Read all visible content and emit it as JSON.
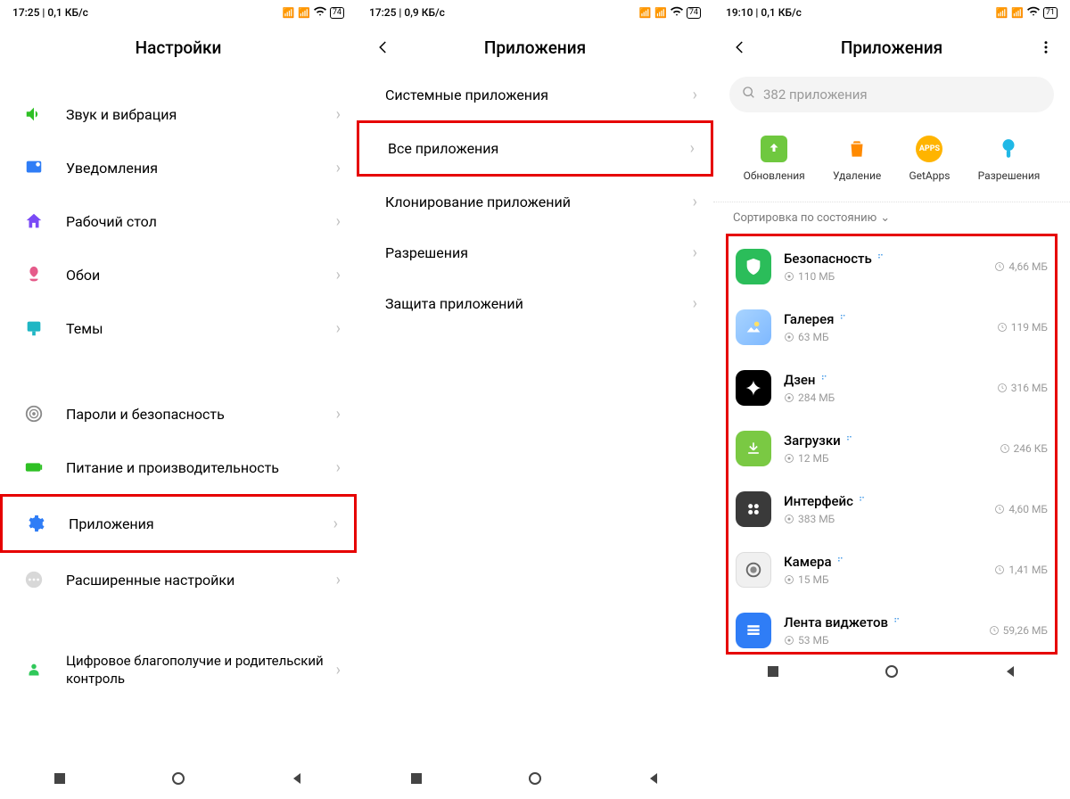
{
  "screen1": {
    "status": {
      "time": "17:25",
      "speed": "0,1 КБ/с",
      "battery": "74"
    },
    "title": "Настройки",
    "rows": [
      {
        "label": "Звук и вибрация",
        "icon": "speaker",
        "color": "#2ec024"
      },
      {
        "label": "Уведомления",
        "icon": "bell",
        "color": "#2f7df6"
      },
      {
        "label": "Рабочий стол",
        "icon": "home",
        "color": "#7a4af6"
      },
      {
        "label": "Обои",
        "icon": "flower",
        "color": "#e55b8a"
      },
      {
        "label": "Темы",
        "icon": "brush",
        "color": "#1fb6c4"
      }
    ],
    "rows2": [
      {
        "label": "Пароли и безопасность",
        "icon": "finger",
        "color": "#8a8a8a"
      },
      {
        "label": "Питание и производительность",
        "icon": "battery",
        "color": "#2ec024"
      },
      {
        "label": "Приложения",
        "icon": "gear",
        "color": "#2f7df6",
        "hl": true
      },
      {
        "label": "Расширенные настройки",
        "icon": "dots",
        "color": "#c0c0c0"
      }
    ],
    "rows3": [
      {
        "label": "Цифровое благополучие и родительский контроль",
        "icon": "heart",
        "color": "#30c85a"
      }
    ]
  },
  "screen2": {
    "status": {
      "time": "17:25",
      "speed": "0,9 КБ/с",
      "battery": "74"
    },
    "title": "Приложения",
    "rows": [
      {
        "label": "Системные приложения"
      },
      {
        "label": "Все приложения",
        "hl": true
      },
      {
        "label": "Клонирование приложений"
      },
      {
        "label": "Разрешения"
      },
      {
        "label": "Защита приложений"
      }
    ]
  },
  "screen3": {
    "status": {
      "time": "19:10",
      "speed": "0,1 КБ/с",
      "battery": "71"
    },
    "title": "Приложения",
    "search_placeholder": "382 приложения",
    "actions": [
      {
        "label": "Обновления",
        "color": "#6fc83f"
      },
      {
        "label": "Удаление",
        "color": "#ff8a00"
      },
      {
        "label": "GetApps",
        "color": "#ffb400"
      },
      {
        "label": "Разрешения",
        "color": "#20b8e6"
      }
    ],
    "sort_label": "Сортировка по состоянию",
    "apps": [
      {
        "name": "Безопасность",
        "storage": "110 МБ",
        "data": "4,66 МБ",
        "icon_bg": "#2bbd5a"
      },
      {
        "name": "Галерея",
        "storage": "63 МБ",
        "data": "119 МБ",
        "icon_bg": "linear-gradient(135deg,#7eb8ff,#a8d4ff)"
      },
      {
        "name": "Дзен",
        "storage": "284 МБ",
        "data": "316 МБ",
        "icon_bg": "#000"
      },
      {
        "name": "Загрузки",
        "storage": "12 МБ",
        "data": "246 КБ",
        "icon_bg": "#7ac943"
      },
      {
        "name": "Интерфейс",
        "storage": "383 МБ",
        "data": "4,60 МБ",
        "icon_bg": "#3a3a3a"
      },
      {
        "name": "Камера",
        "storage": "15 МБ",
        "data": "1,41 МБ",
        "icon_bg": "#f0f0f0"
      },
      {
        "name": "Лента виджетов",
        "storage": "53 МБ",
        "data": "59,26 МБ",
        "icon_bg": "#2f7df6"
      }
    ]
  }
}
